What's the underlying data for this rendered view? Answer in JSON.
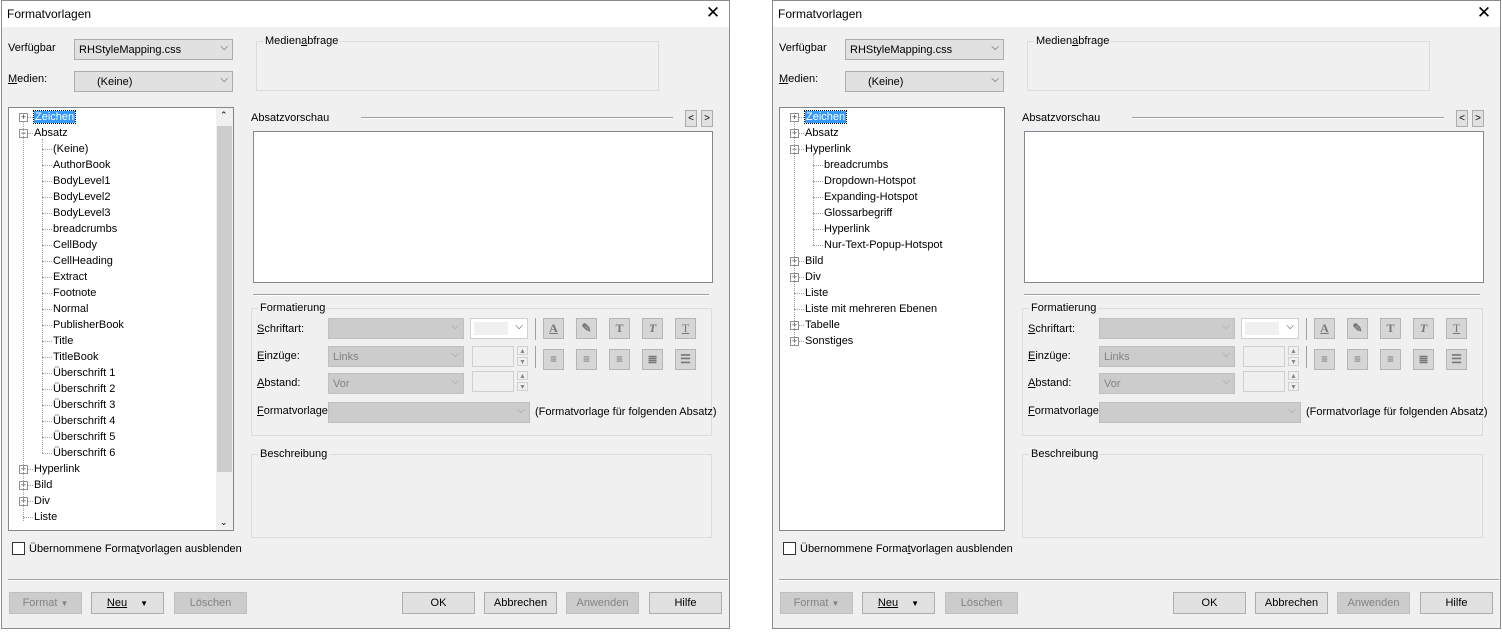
{
  "dialog_title": "Formatvorlagen",
  "labels": {
    "verfuegbar": "Verfügbar",
    "medien": "Medien:",
    "medienabfrage": "Medienabfrage",
    "absatzvorschau": "Absatzvorschau",
    "formatierung": "Formatierung",
    "schriftart": "Schriftart:",
    "einzuege": "Einzüge:",
    "abstand": "Abstand:",
    "formatvorlage": "Formatvorlage:",
    "folgender_absatz": "(Formatvorlage für folgenden Absatz)",
    "beschreibung": "Beschreibung",
    "hide_inherited": "Übernommene Formatvorlagen ausblenden"
  },
  "values": {
    "verfuegbar": "RHStyleMapping.css",
    "medien": "(Keine)",
    "einzuege": "Links",
    "abstand": "Vor"
  },
  "buttons": {
    "format": "Format",
    "neu": "Neu",
    "loeschen": "Löschen",
    "ok": "OK",
    "abbrechen": "Abbrechen",
    "anwenden": "Anwenden",
    "hilfe": "Hilfe"
  },
  "format_icons": [
    "font-color-icon",
    "highlight-icon",
    "bold-icon",
    "italic-icon",
    "underline-icon"
  ],
  "align_icons": [
    "align-left-icon",
    "align-center-icon",
    "align-right-icon",
    "justify-icon",
    "bullet-list-icon"
  ],
  "left_tree": [
    {
      "label": "Zeichen",
      "level": 0,
      "state": "collapsed",
      "selected": true
    },
    {
      "label": "Absatz",
      "level": 0,
      "state": "expanded"
    },
    {
      "label": "(Keine)",
      "level": 1
    },
    {
      "label": "AuthorBook",
      "level": 1
    },
    {
      "label": "BodyLevel1",
      "level": 1
    },
    {
      "label": "BodyLevel2",
      "level": 1
    },
    {
      "label": "BodyLevel3",
      "level": 1
    },
    {
      "label": "breadcrumbs",
      "level": 1
    },
    {
      "label": "CellBody",
      "level": 1
    },
    {
      "label": "CellHeading",
      "level": 1
    },
    {
      "label": "Extract",
      "level": 1
    },
    {
      "label": "Footnote",
      "level": 1
    },
    {
      "label": "Normal",
      "level": 1
    },
    {
      "label": "PublisherBook",
      "level": 1
    },
    {
      "label": "Title",
      "level": 1
    },
    {
      "label": "TitleBook",
      "level": 1
    },
    {
      "label": "Überschrift 1",
      "level": 1
    },
    {
      "label": "Überschrift 2",
      "level": 1
    },
    {
      "label": "Überschrift 3",
      "level": 1
    },
    {
      "label": "Überschrift 4",
      "level": 1
    },
    {
      "label": "Überschrift 5",
      "level": 1
    },
    {
      "label": "Überschrift 6",
      "level": 1
    },
    {
      "label": "Hyperlink",
      "level": 0,
      "state": "collapsed"
    },
    {
      "label": "Bild",
      "level": 0,
      "state": "collapsed"
    },
    {
      "label": "Div",
      "level": 0,
      "state": "collapsed"
    },
    {
      "label": "Liste",
      "level": 0
    }
  ],
  "right_tree": [
    {
      "label": "Zeichen",
      "level": 0,
      "state": "collapsed",
      "selected": true
    },
    {
      "label": "Absatz",
      "level": 0,
      "state": "collapsed"
    },
    {
      "label": "Hyperlink",
      "level": 0,
      "state": "expanded"
    },
    {
      "label": "breadcrumbs",
      "level": 1
    },
    {
      "label": "Dropdown-Hotspot",
      "level": 1
    },
    {
      "label": "Expanding-Hotspot",
      "level": 1
    },
    {
      "label": "Glossarbegriff",
      "level": 1
    },
    {
      "label": "Hyperlink",
      "level": 1
    },
    {
      "label": "Nur-Text-Popup-Hotspot",
      "level": 1
    },
    {
      "label": "Bild",
      "level": 0,
      "state": "collapsed"
    },
    {
      "label": "Div",
      "level": 0,
      "state": "collapsed"
    },
    {
      "label": "Liste",
      "level": 0
    },
    {
      "label": "Liste mit mehreren Ebenen",
      "level": 0
    },
    {
      "label": "Tabelle",
      "level": 0,
      "state": "collapsed"
    },
    {
      "label": "Sonstiges",
      "level": 0,
      "state": "collapsed"
    }
  ]
}
